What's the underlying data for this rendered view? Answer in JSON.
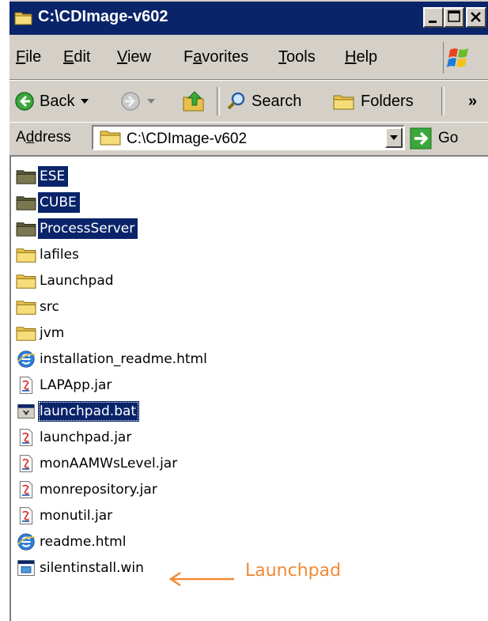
{
  "window": {
    "title": "C:\\CDImage-v602"
  },
  "menubar": {
    "items": [
      {
        "label": "File",
        "key": "F",
        "rest": "ile"
      },
      {
        "label": "Edit",
        "key": "E",
        "rest": "dit"
      },
      {
        "label": "View",
        "key": "V",
        "rest": "iew"
      },
      {
        "label": "Favorites",
        "pre": "F",
        "key": "a",
        "rest": "vorites"
      },
      {
        "label": "Tools",
        "key": "T",
        "rest": "ools"
      },
      {
        "label": "Help",
        "key": "H",
        "rest": "elp"
      }
    ]
  },
  "toolbar": {
    "back_label": "Back",
    "search_label": "Search",
    "folders_label": "Folders",
    "overflow_label": "»"
  },
  "address": {
    "label_pre": "A",
    "label_key": "d",
    "label_rest": "dress",
    "value": "C:\\CDImage-v602",
    "go_label": "Go"
  },
  "files": [
    {
      "name": "ESE",
      "type": "folder-dim",
      "selected": true
    },
    {
      "name": "CUBE",
      "type": "folder-dim",
      "selected": true
    },
    {
      "name": "ProcessServer",
      "type": "folder-dim",
      "selected": true
    },
    {
      "name": "lafiles",
      "type": "folder",
      "selected": false
    },
    {
      "name": "Launchpad",
      "type": "folder",
      "selected": false
    },
    {
      "name": "src",
      "type": "folder",
      "selected": false
    },
    {
      "name": "jvm",
      "type": "folder",
      "selected": false
    },
    {
      "name": "installation_readme.html",
      "type": "html",
      "selected": false
    },
    {
      "name": "LAPApp.jar",
      "type": "jar",
      "selected": false
    },
    {
      "name": "launchpad.bat",
      "type": "bat",
      "selected": true
    },
    {
      "name": "launchpad.jar",
      "type": "jar",
      "selected": false
    },
    {
      "name": "monAAMWsLevel.jar",
      "type": "jar",
      "selected": false
    },
    {
      "name": "monrepository.jar",
      "type": "jar",
      "selected": false
    },
    {
      "name": "monutil.jar",
      "type": "jar",
      "selected": false
    },
    {
      "name": "readme.html",
      "type": "html",
      "selected": false
    },
    {
      "name": "silentinstall.win",
      "type": "win",
      "selected": false
    }
  ],
  "annotation": {
    "text": "Launchpad",
    "color": "#f08a36"
  },
  "colors": {
    "titlebar": "#0a246a",
    "selection": "#0a246a",
    "chrome": "#d4d0c8"
  }
}
